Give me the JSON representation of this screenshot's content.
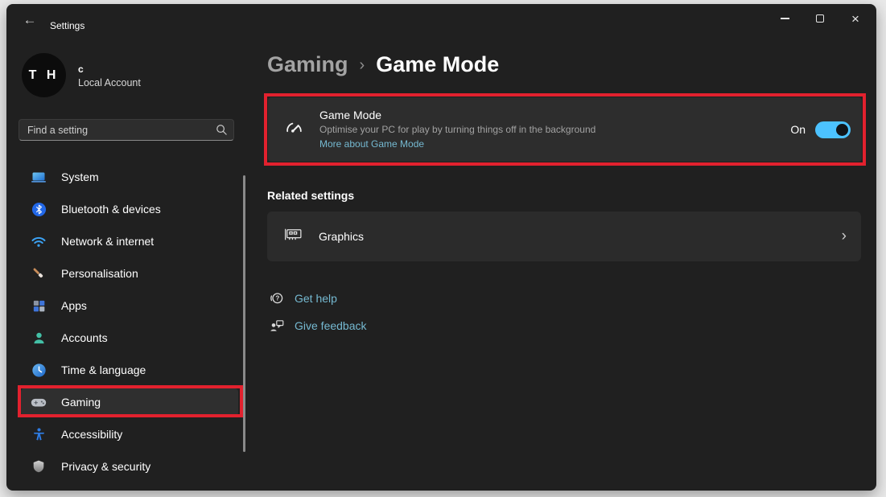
{
  "window": {
    "title": "Settings"
  },
  "titlebar": {
    "back_icon": "back-arrow",
    "minimize_icon": "minimize",
    "maximize_icon": "maximize",
    "close_icon": "close",
    "close_glyph": "×"
  },
  "account": {
    "initials": "T H",
    "name": "c",
    "type": "Local Account"
  },
  "search": {
    "placeholder": "Find a setting",
    "icon": "magnifier"
  },
  "sidebar": {
    "items": [
      {
        "label": "System",
        "icon": "laptop"
      },
      {
        "label": "Bluetooth & devices",
        "icon": "bluetooth"
      },
      {
        "label": "Network & internet",
        "icon": "wifi"
      },
      {
        "label": "Personalisation",
        "icon": "paintbrush"
      },
      {
        "label": "Apps",
        "icon": "app-squares"
      },
      {
        "label": "Accounts",
        "icon": "person"
      },
      {
        "label": "Time & language",
        "icon": "clock"
      },
      {
        "label": "Gaming",
        "icon": "gamepad",
        "selected": true
      },
      {
        "label": "Accessibility",
        "icon": "accessibility-person"
      },
      {
        "label": "Privacy & security",
        "icon": "shield"
      }
    ]
  },
  "main": {
    "breadcrumb": {
      "parent": "Gaming",
      "separator": "›",
      "current": "Game Mode"
    },
    "game_mode": {
      "icon": "speedometer",
      "title": "Game Mode",
      "description": "Optimise your PC for play by turning things off in the background",
      "link": "More about Game Mode",
      "toggle_label": "On",
      "toggle_state": "on"
    },
    "related": {
      "heading": "Related settings",
      "items": [
        {
          "label": "Graphics",
          "icon": "gpu-card",
          "chevron": "›"
        }
      ]
    },
    "footer_links": [
      {
        "label": "Get help",
        "icon": "headset-question"
      },
      {
        "label": "Give feedback",
        "icon": "person-speech-bubble"
      }
    ]
  },
  "colors": {
    "window_bg": "#202020",
    "card_bg": "#2d2d2d",
    "accent_toggle": "#4cc2ff",
    "link": "#75b9d1",
    "annotation_red": "#e2212e",
    "desktop_bg": "#e9e9e9"
  }
}
